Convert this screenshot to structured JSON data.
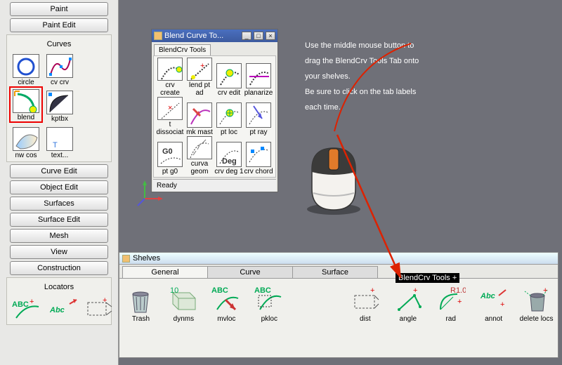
{
  "left_col": {
    "buttons_top": [
      "Paint",
      "Paint Edit"
    ],
    "curves_title": "Curves",
    "curves_tools": [
      {
        "label": "circle"
      },
      {
        "label": "cv crv"
      },
      {
        "label": "blend",
        "selected": true
      },
      {
        "label": "kptbx"
      },
      {
        "label": "nw cos"
      },
      {
        "label": "text..."
      }
    ],
    "buttons_mid": [
      "Curve Edit",
      "Object Edit",
      "Surfaces",
      "Surface Edit",
      "Mesh",
      "View",
      "Construction"
    ],
    "locators_title": "Locators"
  },
  "float_win": {
    "title": "Blend Curve To...",
    "tab": "BlendCrv Tools",
    "tools": [
      {
        "label": "crv create"
      },
      {
        "label": "lend pt ad"
      },
      {
        "label": "crv edit"
      },
      {
        "label": "planarize"
      },
      {
        "label": "t dissociat"
      },
      {
        "label": "mk mast"
      },
      {
        "label": "pt loc"
      },
      {
        "label": "pt ray"
      },
      {
        "label": "pt g0"
      },
      {
        "label": "curva geom"
      },
      {
        "label": "crv deg 1"
      },
      {
        "label": "crv chord"
      }
    ],
    "status": "Ready"
  },
  "instruction": {
    "line1": "Use the middle mouse button to",
    "line2": "drag the BlendCrv Tools Tab onto",
    "line3": "your shelves.",
    "line4": "Be sure to click on the tab labels",
    "line5": "each time."
  },
  "shelves": {
    "title": "Shelves",
    "tabs": [
      {
        "label": "General",
        "active": true
      },
      {
        "label": "Curve"
      },
      {
        "label": "Surface"
      }
    ],
    "drag_label": "BlendCrv Tools  +",
    "items": [
      {
        "label": "Trash"
      },
      {
        "label": "dynms"
      },
      {
        "label": "mvloc"
      },
      {
        "label": "pkloc"
      },
      {
        "label": "dist"
      },
      {
        "label": "angle"
      },
      {
        "label": "rad"
      },
      {
        "label": "annot"
      },
      {
        "label": "delete locs"
      }
    ]
  }
}
